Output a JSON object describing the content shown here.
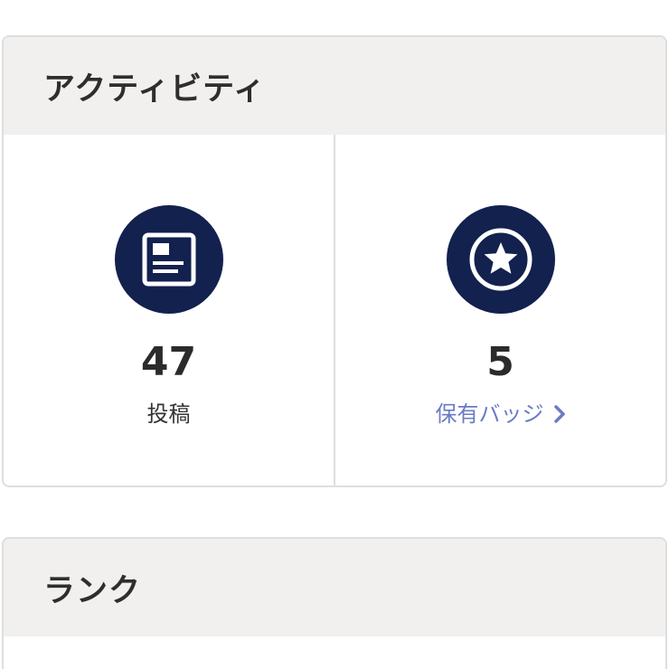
{
  "activity": {
    "title": "アクティビティ",
    "posts": {
      "value": "47",
      "label": "投稿",
      "icon": "article-icon"
    },
    "badges": {
      "value": "5",
      "label": "保有バッジ",
      "icon": "star-badge-icon"
    }
  },
  "rank": {
    "title": "ランク"
  },
  "colors": {
    "icon_bg": "#13214f",
    "link": "#6a7bc4",
    "header_bg": "#f1f0ef"
  }
}
